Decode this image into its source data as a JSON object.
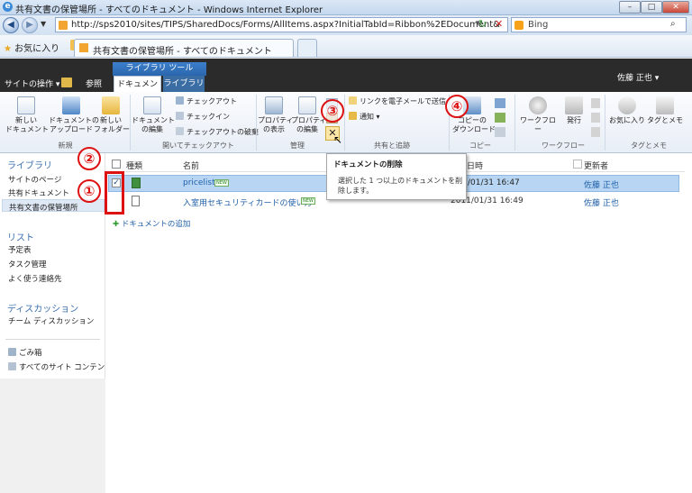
{
  "window": {
    "title": "共有文書の保管場所 - すべてのドキュメント - Windows Internet Explorer"
  },
  "browser": {
    "url": "http://sps2010/sites/TIPS/SharedDocs/Forms/AllItems.aspx?InitialTabId=Ribbon%2EDocument&",
    "search_placeholder": "Bing",
    "favorites_label": "お気に入り",
    "tab_title": "共有文書の保管場所 - すべてのドキュメント"
  },
  "sp": {
    "site_actions": "サイトの操作",
    "browse": "参照",
    "library_tools": "ライブラリ ツール",
    "tab_documents": "ドキュメント",
    "tab_library": "ライブラリ",
    "user": "佐藤 正也"
  },
  "ribbon": {
    "new_doc": "新しい\nドキュメント",
    "upload": "ドキュメントの\nアップロード",
    "new_folder": "新しい\nフォルダー",
    "edit_doc": "ドキュメント\nの編集",
    "checkout": "チェックアウト",
    "checkin": "チェックイン",
    "discard": "チェックアウトの破棄",
    "view_props": "プロパティ\nの表示",
    "edit_props": "プロパティ\nの編集",
    "email_link": "リンクを電子メールで送信",
    "alert": "通知",
    "download_copy": "コピーの\nダウンロード",
    "workflows": "ワークフロー",
    "publish": "発行",
    "favorite": "お気に入り",
    "tags": "タグとメモ",
    "group_new": "新規",
    "group_open": "開いてチェックアウト",
    "group_manage": "管理",
    "group_share": "共有と追跡",
    "group_copy": "コピー",
    "group_workflow": "ワークフロー",
    "group_tags": "タグとメモ"
  },
  "leftnav": {
    "libraries": "ライブラリ",
    "site_pages": "サイトのページ",
    "shared_docs": "共有ドキュメント",
    "storage": "共有文書の保管場所",
    "lists": "リスト",
    "calendar": "予定表",
    "tasks": "タスク管理",
    "contacts": "よく使う連絡先",
    "discussions": "ディスカッション",
    "team_discussion": "チーム ディスカッション",
    "recycle": "ごみ箱",
    "all_content": "すべてのサイト コンテンツ"
  },
  "list": {
    "col_type": "種類",
    "col_name": "名前",
    "col_modified": "日時",
    "col_modified_by": "更新者",
    "new_label": "NEW",
    "add_doc": "ドキュメントの追加",
    "rows": [
      {
        "name": "pricelist",
        "modified": "/01/31 16:47",
        "user": "佐藤 正也"
      },
      {
        "name": "入室用セキュリティカードの使い方",
        "modified": "2011/01/31 16:49",
        "user": "佐藤 正也"
      }
    ]
  },
  "tooltip": {
    "title": "ドキュメントの削除",
    "body": "選択した 1 つ以上のドキュメントを削除します。"
  },
  "annotations": [
    "①",
    "②",
    "③",
    "④"
  ]
}
